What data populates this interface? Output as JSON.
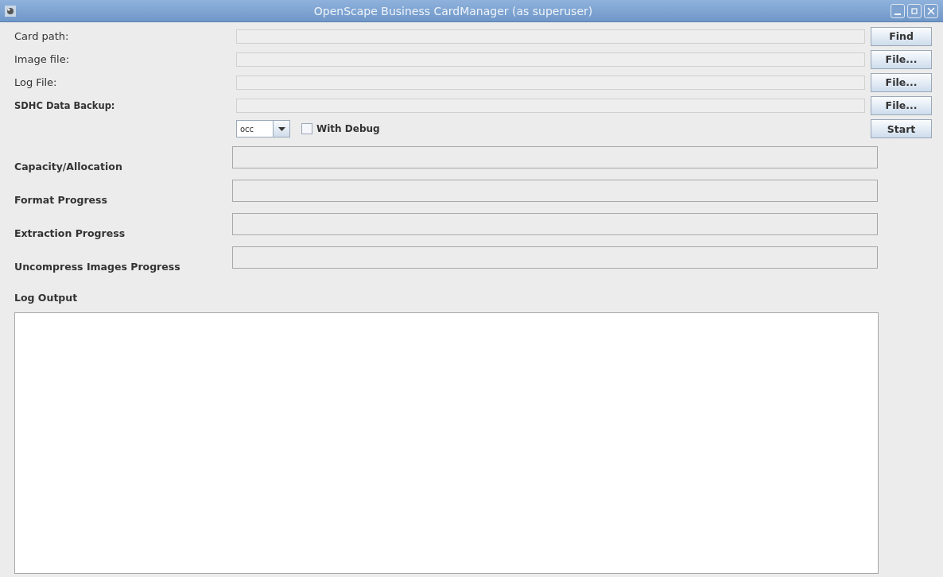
{
  "window": {
    "title": "OpenScape Business CardManager (as superuser)"
  },
  "path_rows": [
    {
      "label": "Card path:",
      "button": "Find"
    },
    {
      "label": "Image file:",
      "button": "File..."
    },
    {
      "label": "Log File:",
      "button": "File..."
    },
    {
      "label": "SDHC Data Backup:",
      "button": "File..."
    }
  ],
  "options": {
    "mode": "occ",
    "debug": {
      "label": "With Debug",
      "checked": false
    },
    "start_button": "Start"
  },
  "progress": [
    {
      "label": "Capacity/Allocation",
      "level": 0
    },
    {
      "label": "Format Progress",
      "level": 0
    },
    {
      "label": "Extraction Progress",
      "level": 0
    },
    {
      "label": "Uncompress Images Progress",
      "level": 0
    }
  ],
  "log": {
    "label": "Log Output"
  }
}
